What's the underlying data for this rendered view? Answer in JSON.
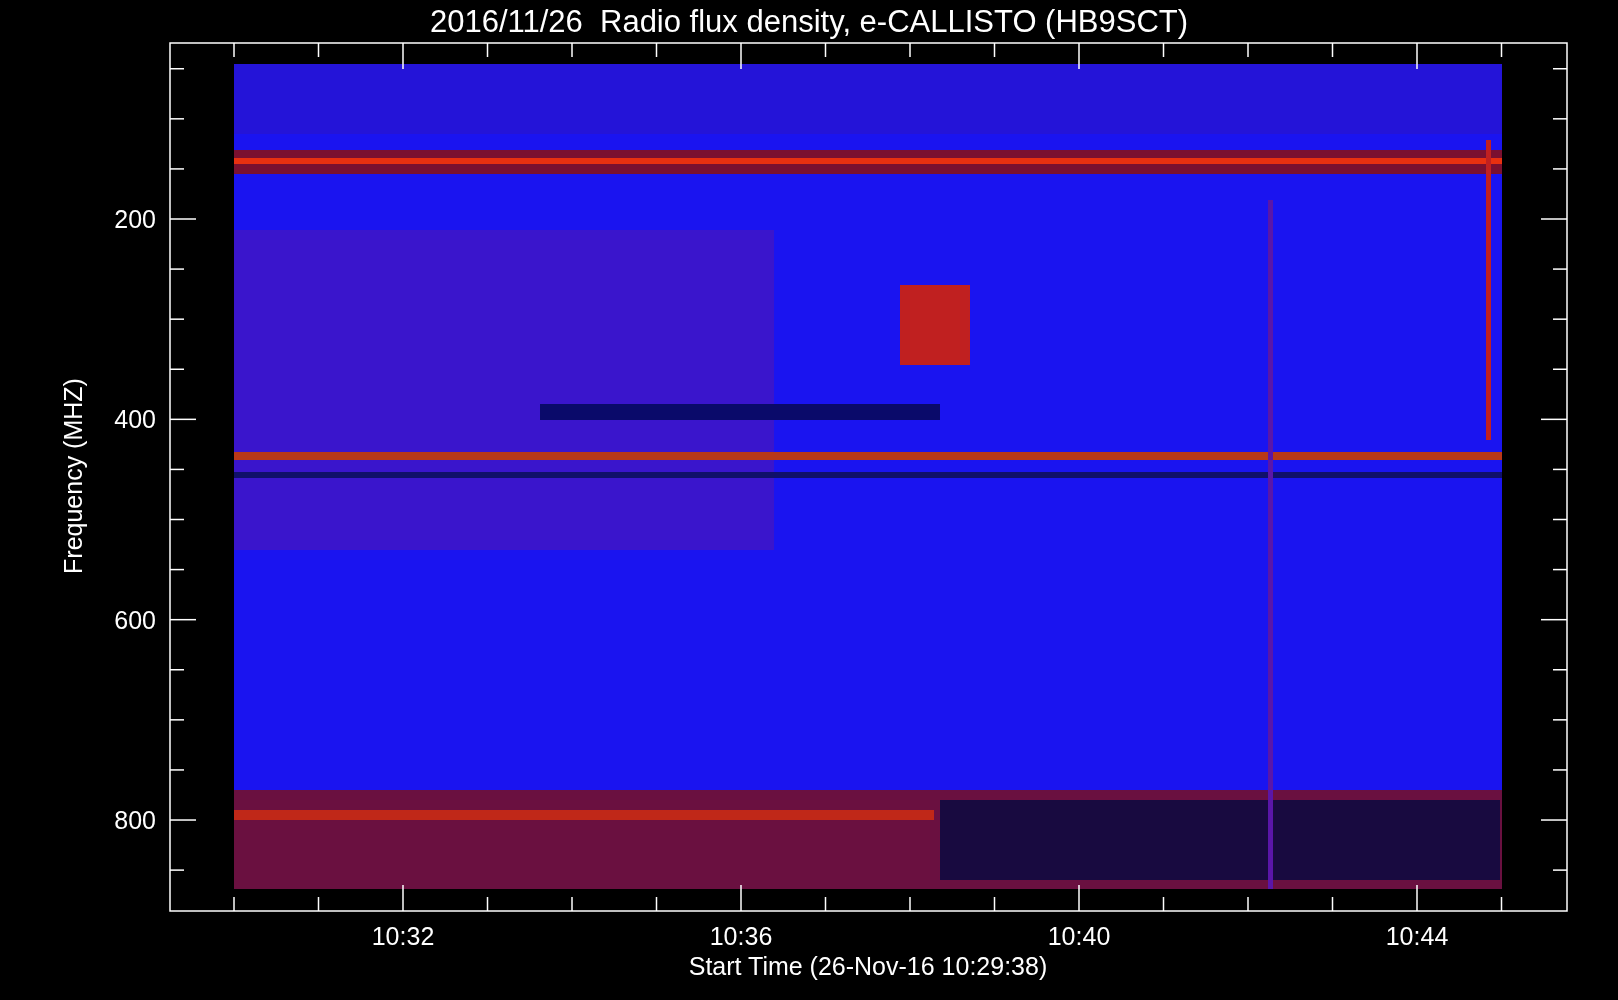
{
  "title": "2016/11/26  Radio flux density, e-CALLISTO (HB9SCT)",
  "plot": {
    "ylabel": "Frequency (MHZ)",
    "xlabel": "Start Time (26-Nov-16 10:29:38)",
    "yticks": [
      "200",
      "400",
      "600",
      "800"
    ],
    "xticks": [
      "10:32",
      "10:36",
      "10:40",
      "10:44"
    ]
  }
}
